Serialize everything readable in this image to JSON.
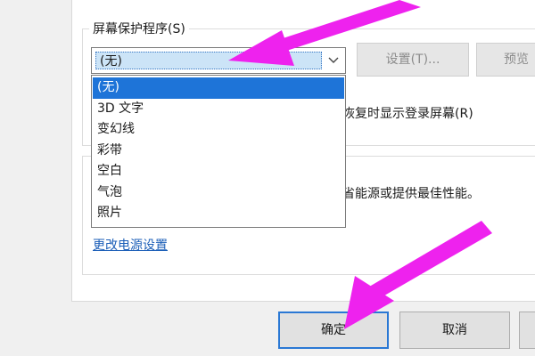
{
  "screensaver": {
    "group_title": "屏幕保护程序(S)",
    "selected_value": "(无)",
    "options": [
      {
        "label": "(无)",
        "selected": true
      },
      {
        "label": "3D 文字",
        "selected": false
      },
      {
        "label": "变幻线",
        "selected": false
      },
      {
        "label": "彩带",
        "selected": false
      },
      {
        "label": "空白",
        "selected": false
      },
      {
        "label": "气泡",
        "selected": false
      },
      {
        "label": "照片",
        "selected": false
      }
    ],
    "settings_label": "设置(T)...",
    "preview_label": "预览",
    "logon_checkbox_label": "恢复时显示登录屏幕(R)"
  },
  "power": {
    "description_fragment": "省能源或提供最佳性能。",
    "change_settings_link": "更改电源设置"
  },
  "buttons": {
    "ok_label": "确定",
    "cancel_label": "取消"
  },
  "colors": {
    "highlight": "#1e74d8",
    "annotation_arrow": "#ee22ee",
    "link": "#1c5fb8"
  }
}
